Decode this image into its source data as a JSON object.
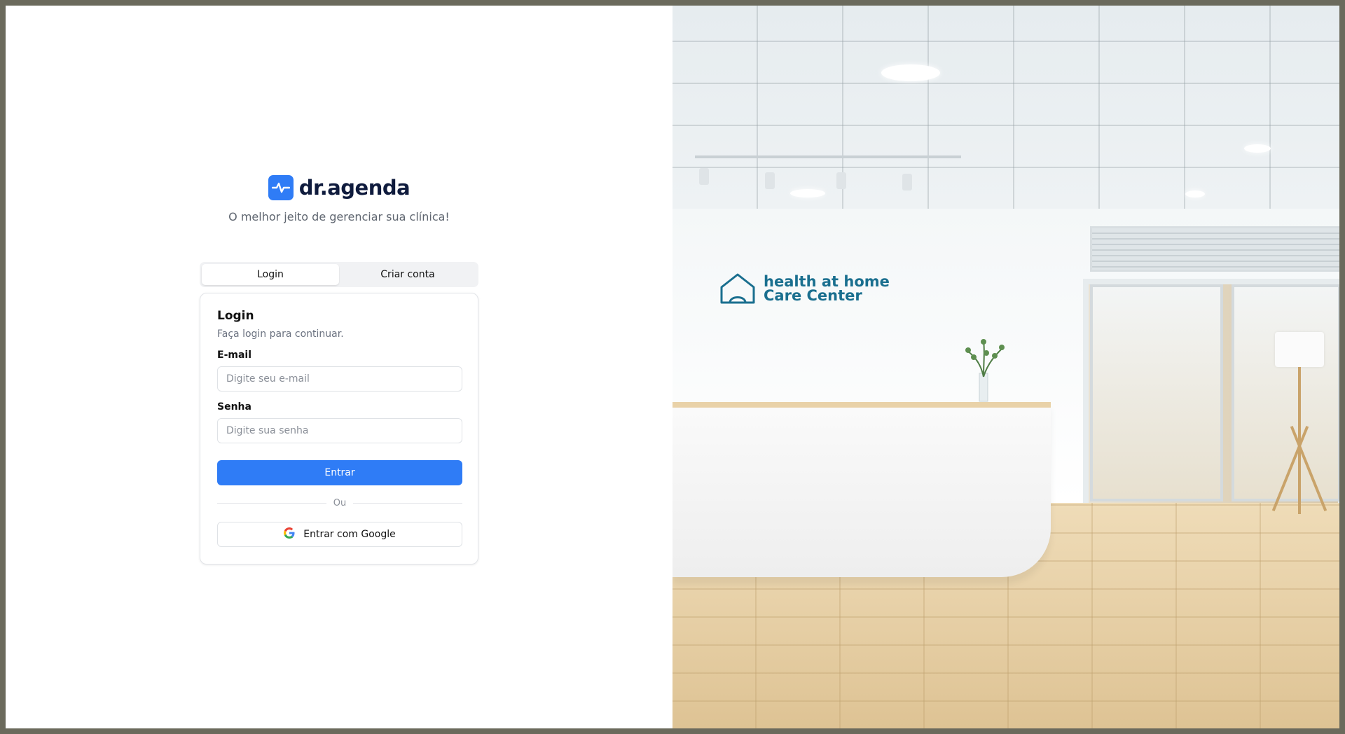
{
  "brand": {
    "name": "dr.agenda",
    "tagline": "O melhor jeito de gerenciar sua clínica!",
    "accent_color": "#2f7cf6",
    "logo_icon": "pulse-icon"
  },
  "tabs": [
    {
      "label": "Login",
      "active": true
    },
    {
      "label": "Criar conta",
      "active": false
    }
  ],
  "login_card": {
    "title": "Login",
    "subtitle": "Faça login para continuar.",
    "email": {
      "label": "E-mail",
      "placeholder": "Digite seu e-mail",
      "value": ""
    },
    "password": {
      "label": "Senha",
      "placeholder": "Digite sua senha",
      "value": ""
    },
    "submit_label": "Entrar",
    "divider_label": "Ou",
    "google_label": "Entrar com Google",
    "google_icon": "google-icon"
  },
  "hero_image": {
    "sign_line1": "health at home",
    "sign_line2": "Care Center"
  }
}
